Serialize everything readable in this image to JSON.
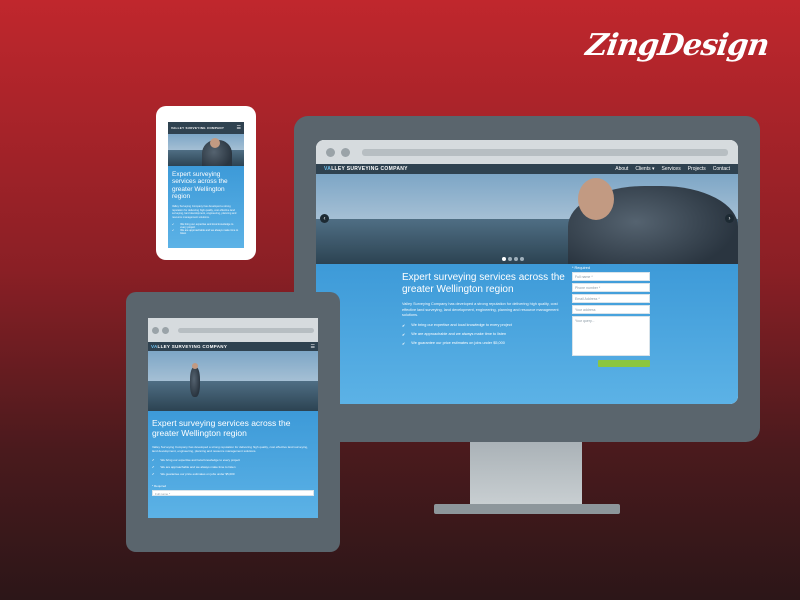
{
  "brand_logo": "ZingDesign",
  "site": {
    "company_name": "VALLEY SURVEYING COMPANY",
    "company_name_rest": "LLEY SURVEYING COMPANY",
    "company_name_first": "VA",
    "nav": [
      "About",
      "Clients",
      "Services",
      "Projects",
      "Contact"
    ],
    "headline": "Expert surveying services across the greater Wellington region",
    "lead": "Valley Surveying Company has developed a strong reputation for delivering high quality, cost effective land surveying, land development, engineering, planning and resource management solutions.",
    "benefits": [
      "We bring our expertise and local knowledge to every project",
      "We are approachable and we always make time to listen",
      "We guarantee our price estimates on jobs under $5,000"
    ],
    "form": {
      "required_note": "* Required",
      "full_name": "Full name *",
      "phone": "Phone number *",
      "email": "Email Address *",
      "address": "Your address",
      "query": "Your query..."
    }
  },
  "colors": {
    "background_top": "#c0272d",
    "background_bottom": "#2c1618",
    "device_frame": "#5a656d",
    "nav": "#2f4250",
    "content_blue": "#3d9ad8",
    "submit_green": "#8cc63f"
  }
}
